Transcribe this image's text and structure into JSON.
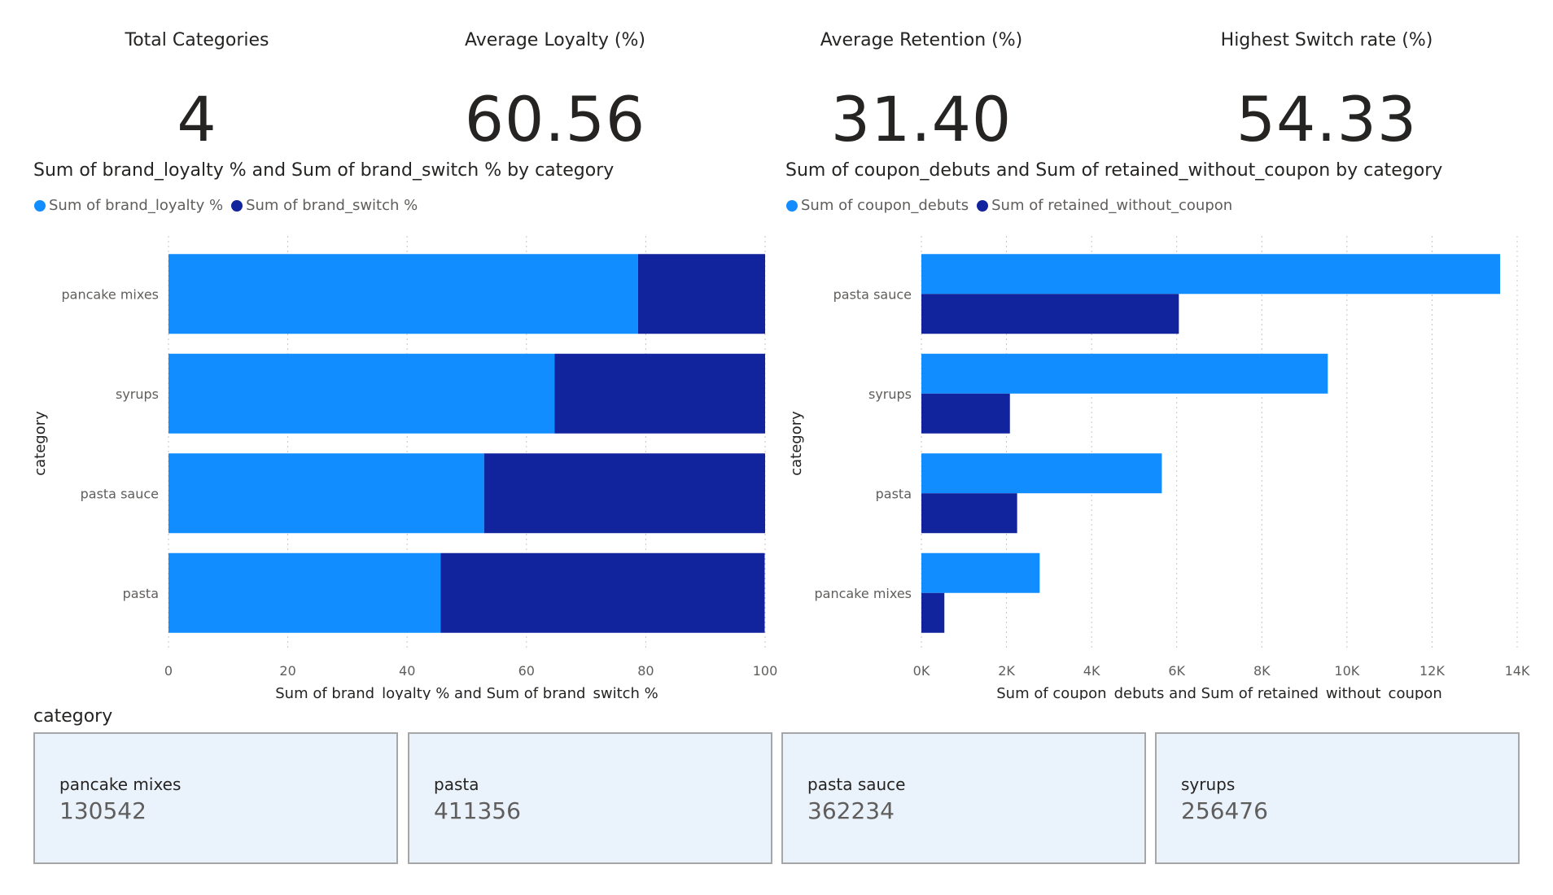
{
  "kpis": [
    {
      "label": "Total Categories",
      "value": "4"
    },
    {
      "label": "Average Loyalty (%)",
      "value": "60.56"
    },
    {
      "label": "Average Retention (%)",
      "value": "31.40"
    },
    {
      "label": "Highest Switch rate (%)",
      "value": "54.33"
    }
  ],
  "colors": {
    "primary": "#118dff",
    "secondary": "#12239e"
  },
  "chart_data": [
    {
      "type": "bar",
      "orientation": "horizontal",
      "stacked": true,
      "title": "Sum of brand_loyalty % and Sum of brand_switch % by category",
      "xlabel": "Sum of brand_loyalty % and Sum of brand_switch %",
      "ylabel": "category",
      "categories": [
        "pancake mixes",
        "syrups",
        "pasta sauce",
        "pasta"
      ],
      "series": [
        {
          "name": "Sum of brand_loyalty %",
          "values": [
            78.7,
            64.7,
            52.9,
            45.6
          ]
        },
        {
          "name": "Sum of brand_switch %",
          "values": [
            21.3,
            35.3,
            47.1,
            54.33
          ]
        }
      ],
      "xlim": [
        0,
        100
      ],
      "xticks": [
        "0",
        "20",
        "40",
        "60",
        "80",
        "100"
      ],
      "grid": true,
      "legend": "top-left"
    },
    {
      "type": "bar",
      "orientation": "horizontal",
      "stacked": false,
      "title": "Sum of coupon_debuts and Sum of retained_without_coupon by category",
      "xlabel": "Sum of coupon_debuts and Sum of retained_without_coupon",
      "ylabel": "category",
      "categories": [
        "pasta sauce",
        "syrups",
        "pasta",
        "pancake mixes"
      ],
      "series": [
        {
          "name": "Sum of coupon_debuts",
          "values": [
            13600,
            9550,
            5650,
            2780
          ]
        },
        {
          "name": "Sum of retained_without_coupon",
          "values": [
            6050,
            2080,
            2250,
            540
          ]
        }
      ],
      "xlim": [
        0,
        14000
      ],
      "xticks": [
        "0K",
        "2K",
        "4K",
        "6K",
        "8K",
        "10K",
        "12K",
        "14K"
      ],
      "grid": true,
      "legend": "top-left"
    }
  ],
  "slicer": {
    "title": "category",
    "cards": [
      {
        "label": "pancake mixes",
        "value": "130542"
      },
      {
        "label": "pasta",
        "value": "411356"
      },
      {
        "label": "pasta sauce",
        "value": "362234"
      },
      {
        "label": "syrups",
        "value": "256476"
      }
    ]
  }
}
